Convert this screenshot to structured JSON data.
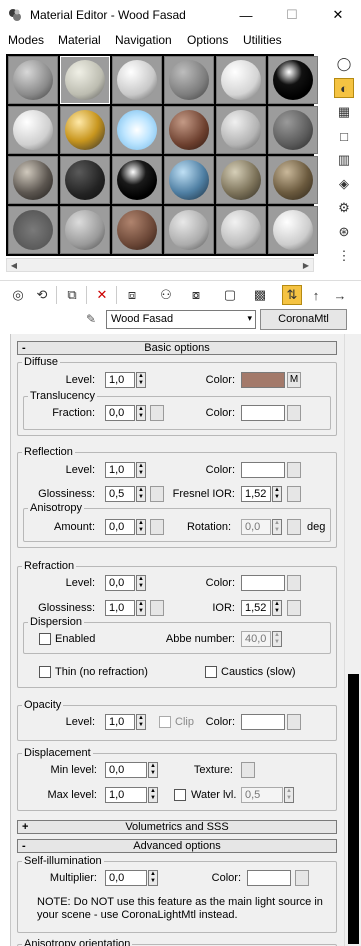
{
  "window": {
    "title": "Material Editor - Wood Fasad",
    "minimize": "—",
    "maximize": "☐",
    "close": "✕"
  },
  "menu": [
    "Modes",
    "Material",
    "Navigation",
    "Options",
    "Utilities"
  ],
  "slots": [
    {
      "sphere": "radial-gradient(circle at 35% 30%, #d8d8d8, #8a8a8a 60%, #3a3a3a)"
    },
    {
      "sphere": "radial-gradient(circle at 35% 30%, #f0f0e6, #bcbcb0 60%, #555)"
    },
    {
      "sphere": "radial-gradient(circle at 35% 30%, #ffffff, #c8c8c8 60%, #5a5a5a)"
    },
    {
      "sphere": "radial-gradient(circle at 35% 30%, #bdbdbd, #7d7d7d 60%, #3c3c3c)"
    },
    {
      "sphere": "radial-gradient(circle at 35% 30%, #ffffff, #d4d4d4 60%, #5f5f5f)"
    },
    {
      "sphere": "radial-gradient(circle at 40% 30%, #ffffff, #111 35%, #000 70%)"
    },
    {
      "sphere": "radial-gradient(circle at 35% 30%, #ffffff, #cfcfcf 60%, #666)"
    },
    {
      "sphere": "radial-gradient(circle at 35% 30%, #ffe9a8, #c8961e 50%, #2d2d2d)"
    },
    {
      "sphere": "radial-gradient(circle at 50% 50%, #ffffff, #bfe6ff 45%, #6fb7e8)"
    },
    {
      "sphere": "radial-gradient(circle at 35% 30%, #c49a86, #6c3f2e 60%, #2a1710)"
    },
    {
      "sphere": "radial-gradient(circle at 35% 30%, #f0f0f0, #b3b3b3 60%, #555)"
    },
    {
      "sphere": "radial-gradient(circle at 35% 30%, #9a9a9a, #5a5a5a 60%, #262626)"
    },
    {
      "sphere": "radial-gradient(circle at 35% 30%, #d0c9bd, #5c5650 55%, #1e1c1a)"
    },
    {
      "sphere": "radial-gradient(circle at 35% 30%, #5a5a5a, #222 60%, #0d0d0d)"
    },
    {
      "sphere": "radial-gradient(circle at 40% 30%, #ffffff, #1a1a1a 35%, #000 70%)"
    },
    {
      "sphere": "radial-gradient(circle at 35% 30%, #bfe0f5, #4f7fa3 55%, #1b2d3d)"
    },
    {
      "sphere": "radial-gradient(circle at 35% 30%, #d6cfb8, #7d735a 55%, #2e2a20)"
    },
    {
      "sphere": "radial-gradient(circle at 35% 30%, #c9b89a, #6b5a3e 55%, #2b2418)"
    },
    {
      "sphere": "radial-gradient(circle at 50% 50%, #7a7a7a, #5a5a5a 70%, #444)"
    },
    {
      "sphere": "radial-gradient(circle at 35% 30%, #dcdcdc, #9a9a9a 60%, #4a4a4a)"
    },
    {
      "sphere": "radial-gradient(circle at 35% 30%, #b0846e, #6a4636 60%, #2b1a12)"
    },
    {
      "sphere": "radial-gradient(circle at 35% 30%, #e8e8e8, #acacac 60%, #4d4d4d)"
    },
    {
      "sphere": "radial-gradient(circle at 35% 30%, #f2f2f2, #bdbdbd 60%, #5c5c5c)"
    },
    {
      "sphere": "radial-gradient(circle at 35% 30%, #ffffff, #cccccc 60%, #5e5e5e)"
    }
  ],
  "material": {
    "name": "Wood Fasad",
    "type": "CoronaMtl",
    "dropdown_arrow": "▾"
  },
  "rollouts": {
    "basic": "Basic options",
    "volumetrics": "Volumetrics and SSS",
    "advanced": "Advanced options",
    "collapse_sign": "-",
    "expand_sign": "+"
  },
  "diffuse": {
    "title": "Diffuse",
    "level_label": "Level:",
    "level": "1,0",
    "color_label": "Color:",
    "color": "#a3796a",
    "map_label": "M"
  },
  "translucency": {
    "title": "Translucency",
    "fraction_label": "Fraction:",
    "fraction": "0,0",
    "color_label": "Color:",
    "color": "#ffffff"
  },
  "reflection": {
    "title": "Reflection",
    "level_label": "Level:",
    "level": "1,0",
    "color_label": "Color:",
    "color": "#ffffff",
    "gloss_label": "Glossiness:",
    "gloss": "0,5",
    "fresnel_label": "Fresnel IOR:",
    "fresnel": "1,52"
  },
  "anisotropy": {
    "title": "Anisotropy",
    "amount_label": "Amount:",
    "amount": "0,0",
    "rotation_label": "Rotation:",
    "rotation": "0,0",
    "unit": "deg"
  },
  "refraction": {
    "title": "Refraction",
    "level_label": "Level:",
    "level": "0,0",
    "color_label": "Color:",
    "color": "#ffffff",
    "gloss_label": "Glossiness:",
    "gloss": "1,0",
    "ior_label": "IOR:",
    "ior": "1,52"
  },
  "dispersion": {
    "title": "Dispersion",
    "enabled_label": "Enabled",
    "abbe_label": "Abbe number:",
    "abbe": "40,0"
  },
  "thin_label": "Thin (no refraction)",
  "caustics_label": "Caustics (slow)",
  "opacity": {
    "title": "Opacity",
    "level_label": "Level:",
    "level": "1,0",
    "clip_label": "Clip",
    "color_label": "Color:",
    "color": "#ffffff"
  },
  "displacement": {
    "title": "Displacement",
    "min_label": "Min level:",
    "min": "0,0",
    "texture_label": "Texture:",
    "max_label": "Max level:",
    "max": "1,0",
    "water_label": "Water lvl.",
    "water": "0,5"
  },
  "self_illum": {
    "title": "Self-illumination",
    "multiplier_label": "Multiplier:",
    "multiplier": "0,0",
    "color_label": "Color:",
    "color": "#ffffff",
    "note": "NOTE: Do NOT use this feature as the main light source in your scene - use CoronaLightMtl instead."
  },
  "aniso_orientation_title": "Anisotropy orientation"
}
